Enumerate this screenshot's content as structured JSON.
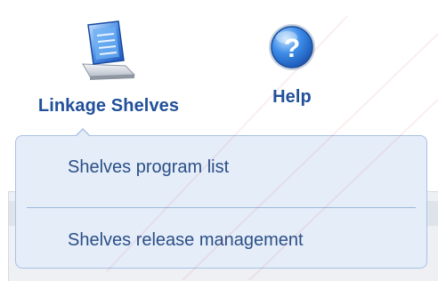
{
  "toolbar": {
    "linkage_shelves": {
      "label": "Linkage Shelves",
      "icon": "linkage-shelves-icon"
    },
    "help": {
      "label": "Help",
      "icon": "help-icon"
    }
  },
  "popup_menu": {
    "items": [
      {
        "label": "Shelves program list"
      },
      {
        "label": "Shelves release management"
      }
    ]
  },
  "colors": {
    "label_blue": "#21509a",
    "menu_text": "#2b4f86",
    "menu_background": "#e5edf9",
    "menu_border": "#a9c1e4"
  }
}
